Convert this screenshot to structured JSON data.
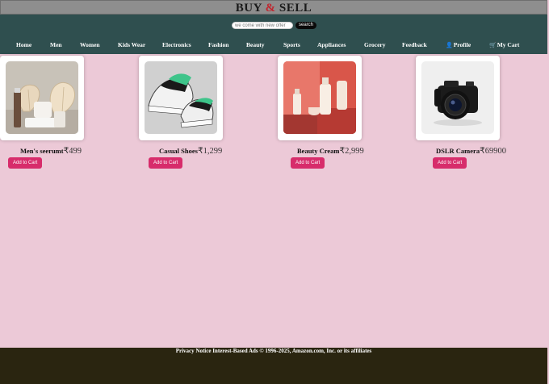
{
  "brand": {
    "part1": "BUY ",
    "amp": "&",
    "part2": " SELL"
  },
  "search": {
    "placeholder": "we come with new offer",
    "button_label": "search"
  },
  "nav": {
    "items": [
      "Home",
      "Men",
      "Women",
      "Kids Wear",
      "Electronics",
      "Fashion",
      "Beauty",
      "Sports",
      "Appliances",
      "Grocery",
      "Feedback"
    ],
    "profile_label": "Profile",
    "cart_label": "My Cart",
    "profile_icon": "person-icon",
    "cart_icon": "cart-icon"
  },
  "products": [
    {
      "name": "Men's seerumt",
      "price": "₹499",
      "button": "Add to Cart",
      "image": "skincare-bottles-with-monstera-leaves"
    },
    {
      "name": "Casual Shoes",
      "price": "₹1,299",
      "button": "Add to Cart",
      "image": "sneakers-black-white-green"
    },
    {
      "name": "Beauty Cream",
      "price": "₹2,999",
      "button": "Add to Cart",
      "image": "cosmetic-bottles-on-red-podium"
    },
    {
      "name": "DSLR Camera",
      "price": "₹69900",
      "button": "Add to Cart",
      "image": "black-dslr-camera"
    }
  ],
  "footer": {
    "text": "Privacy Notice Interest-Based Ads © 1996-2025, Amazon.com, Inc. or its affiliates"
  },
  "colors": {
    "page_bg": "#ecc9d7",
    "header_bg": "#2f4f4f",
    "titlebar_bg": "#8e8e8e",
    "button_bg": "#d72c6b",
    "footer_bg": "#2a2510",
    "brand_amp": "#c0262f"
  }
}
